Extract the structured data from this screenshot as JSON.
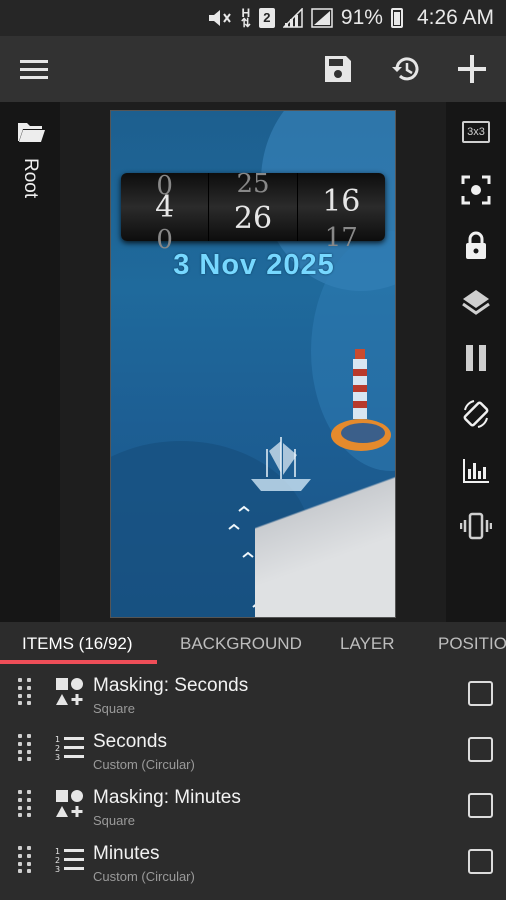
{
  "status_bar": {
    "battery": "91%",
    "time": "4:26 AM",
    "sim_slot": "2",
    "network_indicator": "H",
    "icons": [
      "mute-icon",
      "sim-icon",
      "signal-icon",
      "signal-icon",
      "battery-icon"
    ]
  },
  "toolbar": {
    "icons": [
      "menu-icon",
      "save-icon",
      "history-icon",
      "add-icon"
    ]
  },
  "left_rail": {
    "folder_icon": "folder-open-icon",
    "label": "Root"
  },
  "right_rail": {
    "grid_label": "3x3",
    "icons": [
      "grid-3x3-icon",
      "focus-icon",
      "lock-icon",
      "layers-icon",
      "pause-icon",
      "rotate-icon",
      "equalizer-icon",
      "vibrate-icon"
    ]
  },
  "canvas": {
    "clock_digits": [
      {
        "main": "4",
        "ghost_top": "0",
        "ghost_bottom": "0"
      },
      {
        "main": "26",
        "ghost_top": "25",
        "ghost_bottom": ""
      },
      {
        "main": "16",
        "ghost_top": "",
        "ghost_bottom": "17"
      }
    ],
    "date": "3 Nov 2025"
  },
  "tabs": [
    {
      "label": "ITEMS (16/92)",
      "active": true
    },
    {
      "label": "BACKGROUND",
      "active": false
    },
    {
      "label": "LAYER",
      "active": false
    },
    {
      "label": "POSITIO",
      "active": false
    }
  ],
  "items": [
    {
      "title": "Masking: Seconds",
      "subtitle": "Square",
      "icon": "shapes-icon",
      "checked": false
    },
    {
      "title": "Seconds",
      "subtitle": "Custom (Circular)",
      "icon": "numbered-list-icon",
      "checked": false
    },
    {
      "title": "Masking: Minutes",
      "subtitle": "Square",
      "icon": "shapes-icon",
      "checked": false
    },
    {
      "title": "Minutes",
      "subtitle": "Custom (Circular)",
      "icon": "numbered-list-icon",
      "checked": false
    }
  ],
  "colors": {
    "accent": "#ef4e58",
    "date_text": "#77d8ff",
    "toolbar": "#323232",
    "list_bg": "#2c2c2c"
  }
}
